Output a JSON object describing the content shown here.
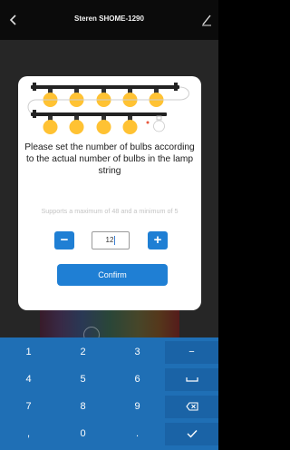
{
  "header": {
    "title": "Steren SHOME-1290",
    "back_icon": "chevron-left-icon",
    "edit_icon": "pencil-icon"
  },
  "dialog": {
    "prompt": "Please set the number of bulbs according to the actual number of bulbs in the lamp string",
    "limits": "Supports a maximum of 48 and a minimum of 5",
    "minus_label": "−",
    "plus_label": "+",
    "bulb_count": "12",
    "confirm_label": "Confirm"
  },
  "keyboard": {
    "rows": [
      [
        "1",
        "2",
        "3",
        "−"
      ],
      [
        "4",
        "5",
        "6",
        "␣"
      ],
      [
        "7",
        "8",
        "9",
        "⌫"
      ],
      [
        ",",
        "0",
        ".",
        "✓"
      ]
    ],
    "key_bg": "#1f6fb5"
  },
  "colors": {
    "accent": "#1f7fd4",
    "bulb": "#ffc233",
    "modal_bg": "#ffffff"
  }
}
